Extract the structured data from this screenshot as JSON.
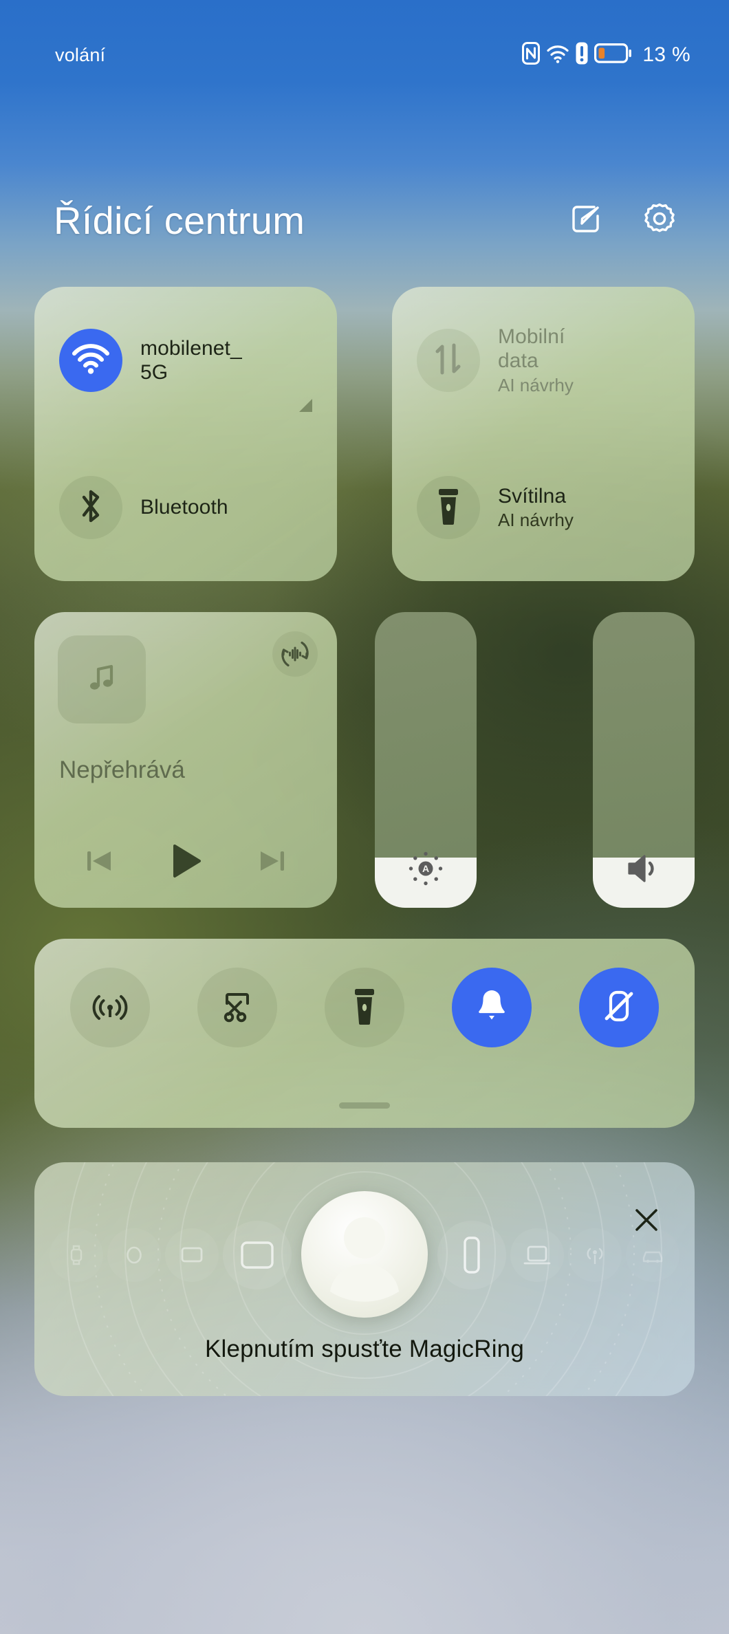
{
  "statusbar": {
    "carrier_label": "volání",
    "nfc_icon": "nfc-icon",
    "wifi_icon": "wifi-icon",
    "alert_icon": "alert-icon",
    "battery_icon": "battery-icon",
    "battery_percent": "13 %"
  },
  "header": {
    "title": "Řídicí centrum",
    "edit_icon": "edit-icon",
    "settings_icon": "gear-icon"
  },
  "tiles": {
    "wifi": {
      "icon": "wifi-icon",
      "title": "mobilenet_",
      "title_line2": "5G",
      "active": true
    },
    "bluetooth": {
      "icon": "bluetooth-icon",
      "title": "Bluetooth",
      "active": false
    },
    "mobile_data": {
      "icon": "data-transfer-icon",
      "title": "Mobilní",
      "title_line2": "data",
      "subtitle": "AI návrhy",
      "active": false,
      "dimmed": true
    },
    "flashlight": {
      "icon": "flashlight-icon",
      "title": "Svítilna",
      "subtitle": "AI návrhy",
      "active": false
    }
  },
  "media": {
    "thumb_icon": "music-note-icon",
    "cast_icon": "audio-output-icon",
    "status": "Nepřehrává",
    "prev_icon": "skip-previous-icon",
    "play_icon": "play-icon",
    "next_icon": "skip-next-icon"
  },
  "sliders": {
    "brightness": {
      "icon": "auto-brightness-icon",
      "value_percent": 17
    },
    "volume": {
      "icon": "volume-icon",
      "value_percent": 17
    }
  },
  "toggles": [
    {
      "icon": "screencast-icon",
      "name": "screencast",
      "active": false
    },
    {
      "icon": "screenshot-scissors-icon",
      "name": "screenshot",
      "active": false
    },
    {
      "icon": "flashlight-icon",
      "name": "flashlight",
      "active": false
    },
    {
      "icon": "bell-icon",
      "name": "ringer",
      "active": true
    },
    {
      "icon": "rotate-lock-icon",
      "name": "auto-rotate",
      "active": true
    }
  ],
  "magicring": {
    "caption": "Klepnutím spusťte MagicRing",
    "close_icon": "close-icon",
    "avatar_icon": "avatar-icon",
    "devices": [
      "watch-icon",
      "earbuds-icon",
      "tv-icon",
      "tablet-icon",
      "phone-icon",
      "laptop-icon",
      "speaker-icon",
      "car-icon"
    ]
  },
  "colors": {
    "accent_blue": "#3a69f0",
    "panel_green": "#c2d4a3",
    "slider_fill": "#f2f3ee",
    "status_orange": "#e8822a",
    "background_top": "#2a6fc9"
  }
}
